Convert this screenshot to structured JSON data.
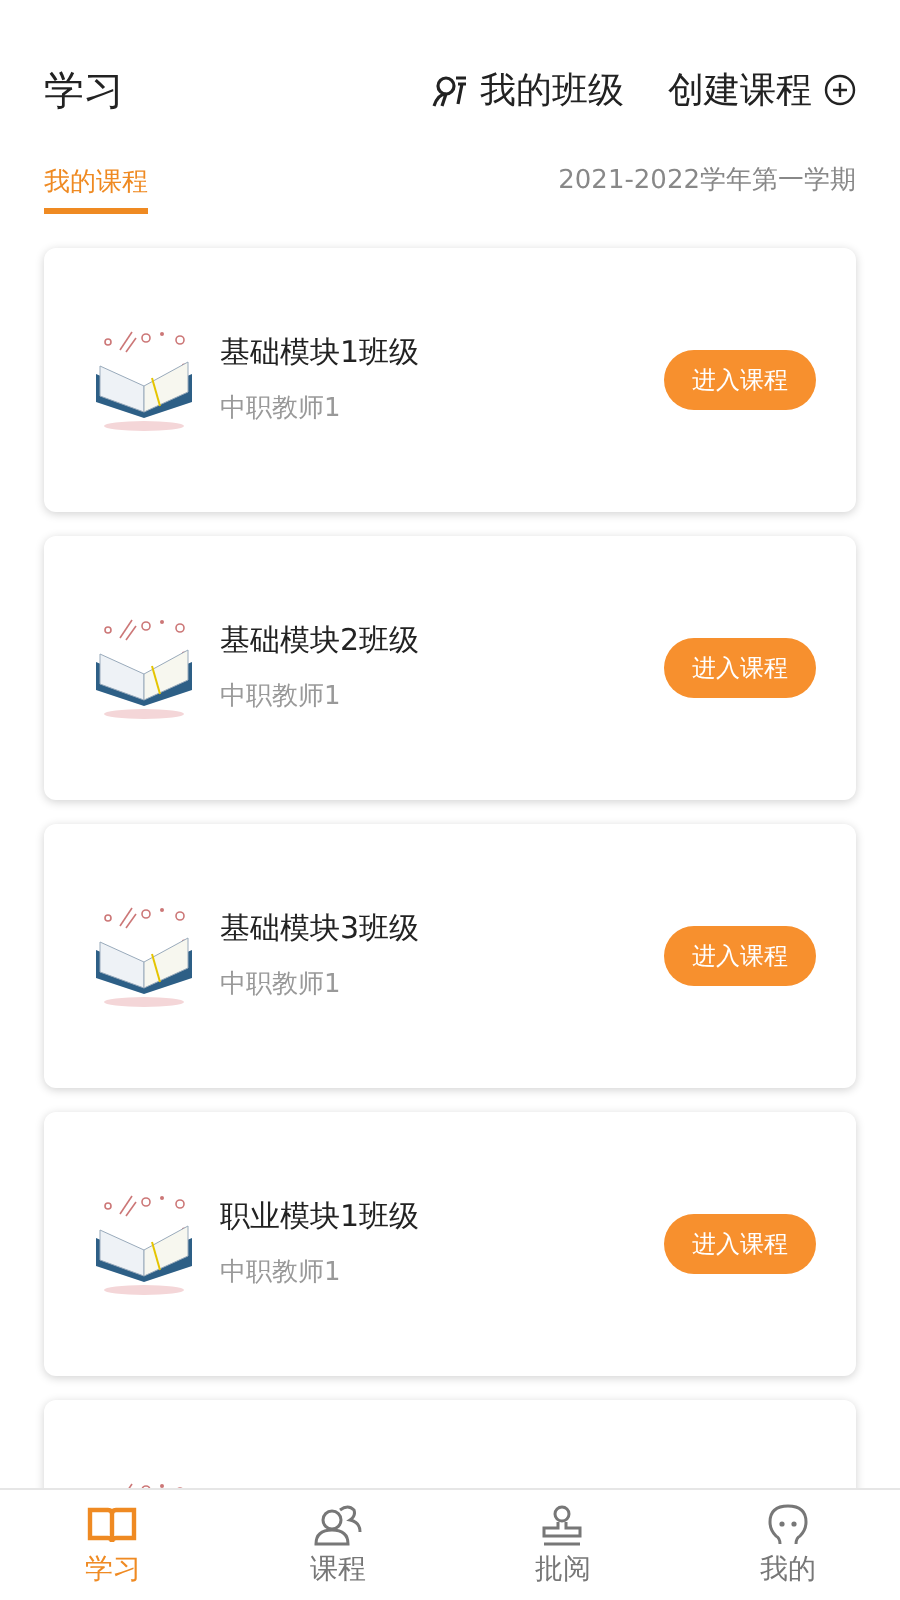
{
  "header": {
    "title": "学习",
    "my_class": "我的班级",
    "create_course": "创建课程"
  },
  "tabs": [
    {
      "label": "我的课程",
      "selected": true
    }
  ],
  "term": "2021-2022学年第一学期",
  "courses": [
    {
      "kind": "full",
      "name": "基础模块1班级",
      "teacher": "中职教师1",
      "button": "进入课程"
    },
    {
      "kind": "full",
      "name": "基础模块2班级",
      "teacher": "中职教师1",
      "button": "进入课程"
    },
    {
      "kind": "full",
      "name": "基础模块3班级",
      "teacher": "中职教师1",
      "button": "进入课程"
    },
    {
      "kind": "full",
      "name": "职业模块1班级",
      "teacher": "中职教师1",
      "button": "进入课程"
    },
    {
      "kind": "cut"
    }
  ],
  "nav": [
    {
      "label": "学习",
      "selected": true
    },
    {
      "label": "课程",
      "selected": false
    },
    {
      "label": "批阅",
      "selected": false
    },
    {
      "label": "我的",
      "selected": false
    }
  ]
}
